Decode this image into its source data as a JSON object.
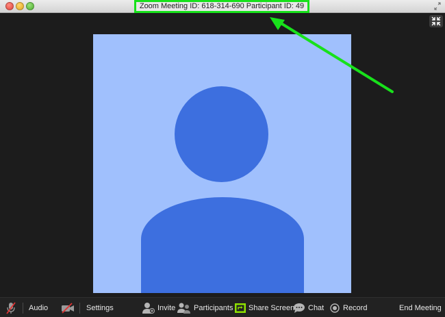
{
  "window": {
    "title": "Zoom Meeting ID: 618-314-690 Participant ID: 49"
  },
  "toolbar": {
    "audio_label": "Audio",
    "settings_label": "Settings",
    "invite_label": "Invite",
    "participants_label": "Participants",
    "share_label": "Share Screen",
    "chat_label": "Chat",
    "record_label": "Record",
    "end_label": "End Meeting"
  },
  "colors": {
    "highlight": "#18e11b",
    "tile_bg": "#a0c0fd",
    "avatar": "#3d6fdf",
    "share_accent": "#8ee000",
    "mute_red": "#e03030"
  },
  "icons": {
    "mic": "microphone-muted-icon",
    "video": "video-off-icon",
    "invite": "invite-person-icon",
    "participants": "participants-icon",
    "share": "share-screen-icon",
    "chat": "chat-bubble-icon",
    "record": "record-icon",
    "exit_fullscreen": "exit-fullscreen-icon"
  }
}
